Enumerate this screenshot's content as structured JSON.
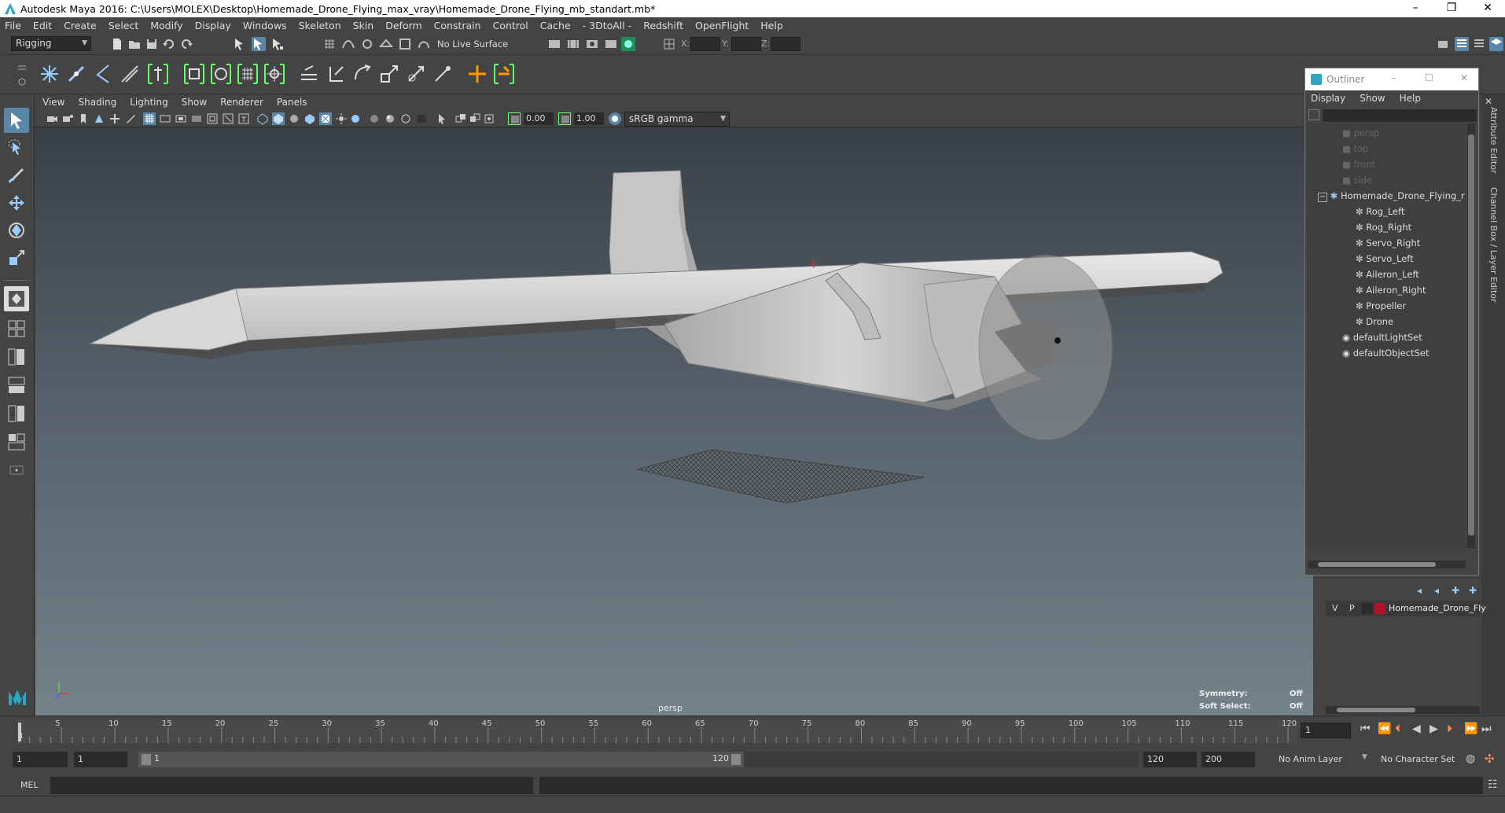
{
  "window": {
    "title": "Autodesk Maya 2016: C:\\Users\\MOLEX\\Desktop\\Homemade_Drone_Flying_max_vray\\Homemade_Drone_Flying_mb_standart.mb*",
    "controls": [
      "–",
      "❐",
      "✕"
    ]
  },
  "menubar": [
    "File",
    "Edit",
    "Create",
    "Select",
    "Modify",
    "Display",
    "Windows",
    "Skeleton",
    "Skin",
    "Deform",
    "Constrain",
    "Control",
    "Cache",
    "- 3DtoAll -",
    "Redshift",
    "OpenFlight",
    "Help"
  ],
  "statusline": {
    "menuset": "Rigging",
    "live_surface": "No Live Surface",
    "x_label": "X:",
    "y_label": "Y:",
    "z_label": "Z:"
  },
  "viewport": {
    "menu": [
      "View",
      "Shading",
      "Lighting",
      "Show",
      "Renderer",
      "Panels"
    ],
    "near_value": "0.00",
    "far_value": "1.00",
    "color_space": "sRGB gamma",
    "camera_label": "persp",
    "symmetry_label": "Symmetry:",
    "symmetry_value": "Off",
    "soft_select_label": "Soft Select:",
    "soft_select_value": "Off"
  },
  "outliner": {
    "title": "Outliner",
    "menu": [
      "Display",
      "Show",
      "Help"
    ],
    "cameras": [
      "persp",
      "top",
      "front",
      "side"
    ],
    "root": "Homemade_Drone_Flying_r",
    "children": [
      "Rog_Left",
      "Rog_Right",
      "Servo_Right",
      "Servo_Left",
      "Aileron_Left",
      "Aileron_Right",
      "Propeller",
      "Drone"
    ],
    "sets": [
      "defaultLightSet",
      "defaultObjectSet"
    ]
  },
  "side_tabs": [
    "Attribute Editor",
    "Channel Box / Layer Editor"
  ],
  "layer_editor": {
    "v": "V",
    "p": "P",
    "layer_name": "Homemade_Drone_Fly",
    "layer_color": "#b0122a"
  },
  "timeline": {
    "ticks": [
      "1",
      "5",
      "10",
      "15",
      "20",
      "25",
      "30",
      "35",
      "40",
      "45",
      "50",
      "55",
      "60",
      "65",
      "70",
      "75",
      "80",
      "85",
      "90",
      "95",
      "100",
      "105",
      "110",
      "115",
      "120"
    ],
    "current_frame": "1"
  },
  "range": {
    "start": "1",
    "inner_start": "1",
    "slider_start": "1",
    "slider_end": "120",
    "end": "120",
    "anim_end": "200",
    "anim_layer": "No Anim Layer",
    "character_set": "No Character Set"
  },
  "cmdline": {
    "label": "MEL"
  }
}
